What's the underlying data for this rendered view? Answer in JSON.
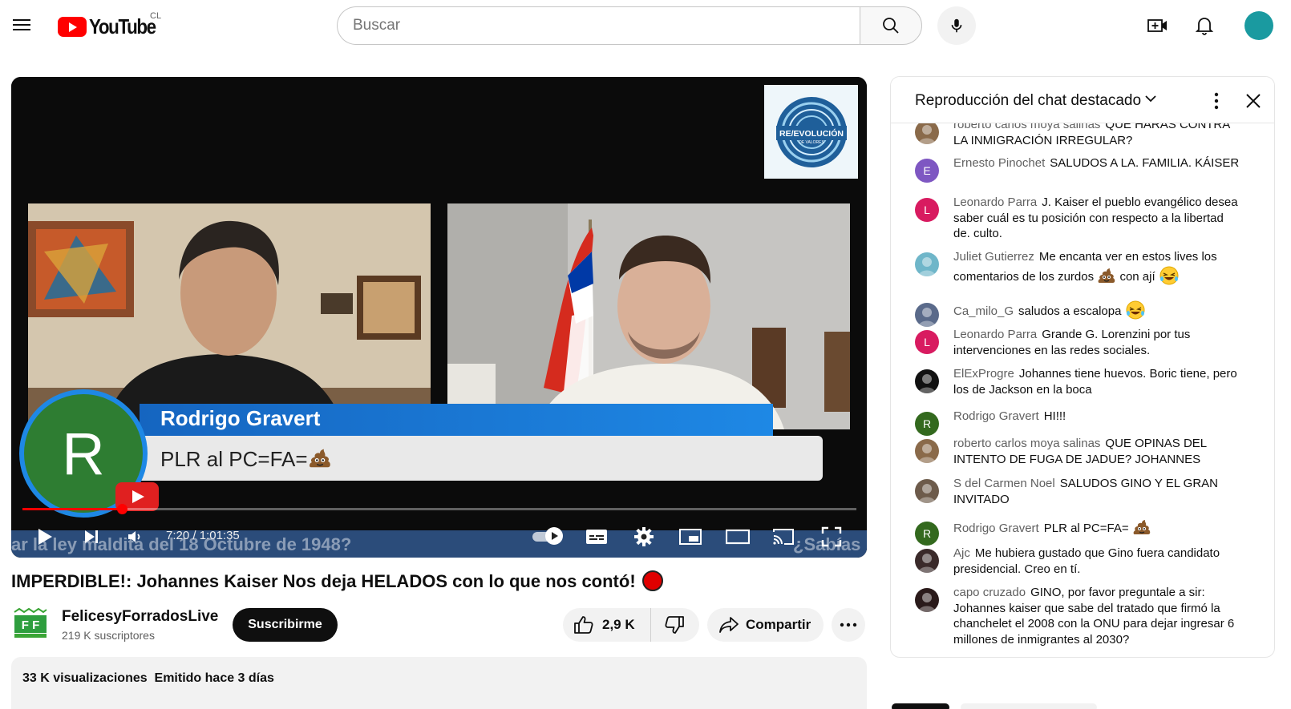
{
  "header": {
    "logo_text": "YouTube",
    "country_code": "CL",
    "search_placeholder": "Buscar"
  },
  "player": {
    "overlay_name": "Rodrigo Gravert",
    "overlay_message": "PLR al PC=FA=",
    "overlay_initial": "R",
    "logo_box_text": "RE/EVOLUCIÓN",
    "logo_box_subtext": "DE VALORES",
    "ticker_text": "ar la ley maldita del 18 Octubre de 1948?",
    "ticker_right": "¿Sabías",
    "time_current": "7:20",
    "time_separator": " / ",
    "time_total": "1:01:35",
    "progress_fraction": 0.119
  },
  "video": {
    "title": "IMPERDIBLE!: Johannes Kaiser Nos deja HELADOS con lo que nos contó!",
    "channel_name": "FelicesyForradosLive",
    "subscribers": "219 K suscriptores",
    "subscribe_label": "Suscribirme",
    "like_count": "2,9 K",
    "share_label": "Compartir",
    "views": "33 K visualizaciones",
    "streamed": "Emitido hace 3 días"
  },
  "chat": {
    "title": "Reproducción del chat destacado",
    "messages": [
      {
        "author": "roberto carlos moya salinas",
        "text": "QUE HARAS CONTRA LA INMIGRACIÓN IRREGULAR?",
        "avatar": "photo",
        "color": "#8a6a4a"
      },
      {
        "author": "Ernesto Pinochet",
        "text": "SALUDOS A LA. FAMILIA. KÁISER",
        "avatar": "E",
        "color": "#7e57c2"
      },
      {
        "author": "Leonardo Parra",
        "text": "J. Kaiser el pueblo evangélico desea saber cuál es tu posición con respecto a la libertad de. culto.",
        "avatar": "L",
        "color": "#d81b60"
      },
      {
        "author": "Juliet Gutierrez",
        "text": "Me encanta ver en estos lives los comentarios de los zurdos",
        "text_after": "con ají",
        "avatar": "photo",
        "color": "#6fb6c9"
      },
      {
        "author": "Ca_milo_G",
        "text": "saludos a escalopa",
        "avatar": "photo",
        "color": "#5a6a8a"
      },
      {
        "author": "Leonardo Parra",
        "text": "Grande G. Lorenzini por tus intervenciones en las redes sociales.",
        "avatar": "L",
        "color": "#d81b60"
      },
      {
        "author": "ElExProgre",
        "text": "Johannes tiene huevos. Boric tiene, pero los de Jackson en la boca",
        "avatar": "photo",
        "color": "#111111"
      },
      {
        "author": "Rodrigo Gravert",
        "text": "HI!!!",
        "avatar": "R",
        "color": "#33691e"
      },
      {
        "author": "roberto carlos moya salinas",
        "text": "QUE OPINAS DEL INTENTO DE FUGA DE JADUE? JOHANNES",
        "avatar": "photo",
        "color": "#8a6a4a"
      },
      {
        "author": "S del Carmen Noel",
        "text": "SALUDOS GINO Y EL GRAN INVITADO",
        "avatar": "photo",
        "color": "#6d5b4b"
      },
      {
        "author": "Rodrigo Gravert",
        "text": "PLR al PC=FA=",
        "avatar": "R",
        "color": "#33691e"
      },
      {
        "author": "Ajc",
        "text": "Me hubiera gustado que Gino fuera candidato presidencial. Creo en tí.",
        "avatar": "photo",
        "color": "#3a2a2a"
      },
      {
        "author": "capo cruzado",
        "text": "GINO, por favor preguntale a sir: Johannes kaiser que sabe del tratado que firmó la chanchelet el 2008 con la ONU para dejar ingresar 6 millones de inmigrantes al 2030?",
        "avatar": "photo",
        "color": "#2a1a1a"
      }
    ]
  },
  "colors": {
    "brand_red": "#ff0000",
    "subscribe_bg": "#0f0f0f",
    "pill_bg": "#f2f2f2",
    "overlay_blue": "#1e88e5",
    "overlay_green": "#2e7d32"
  }
}
